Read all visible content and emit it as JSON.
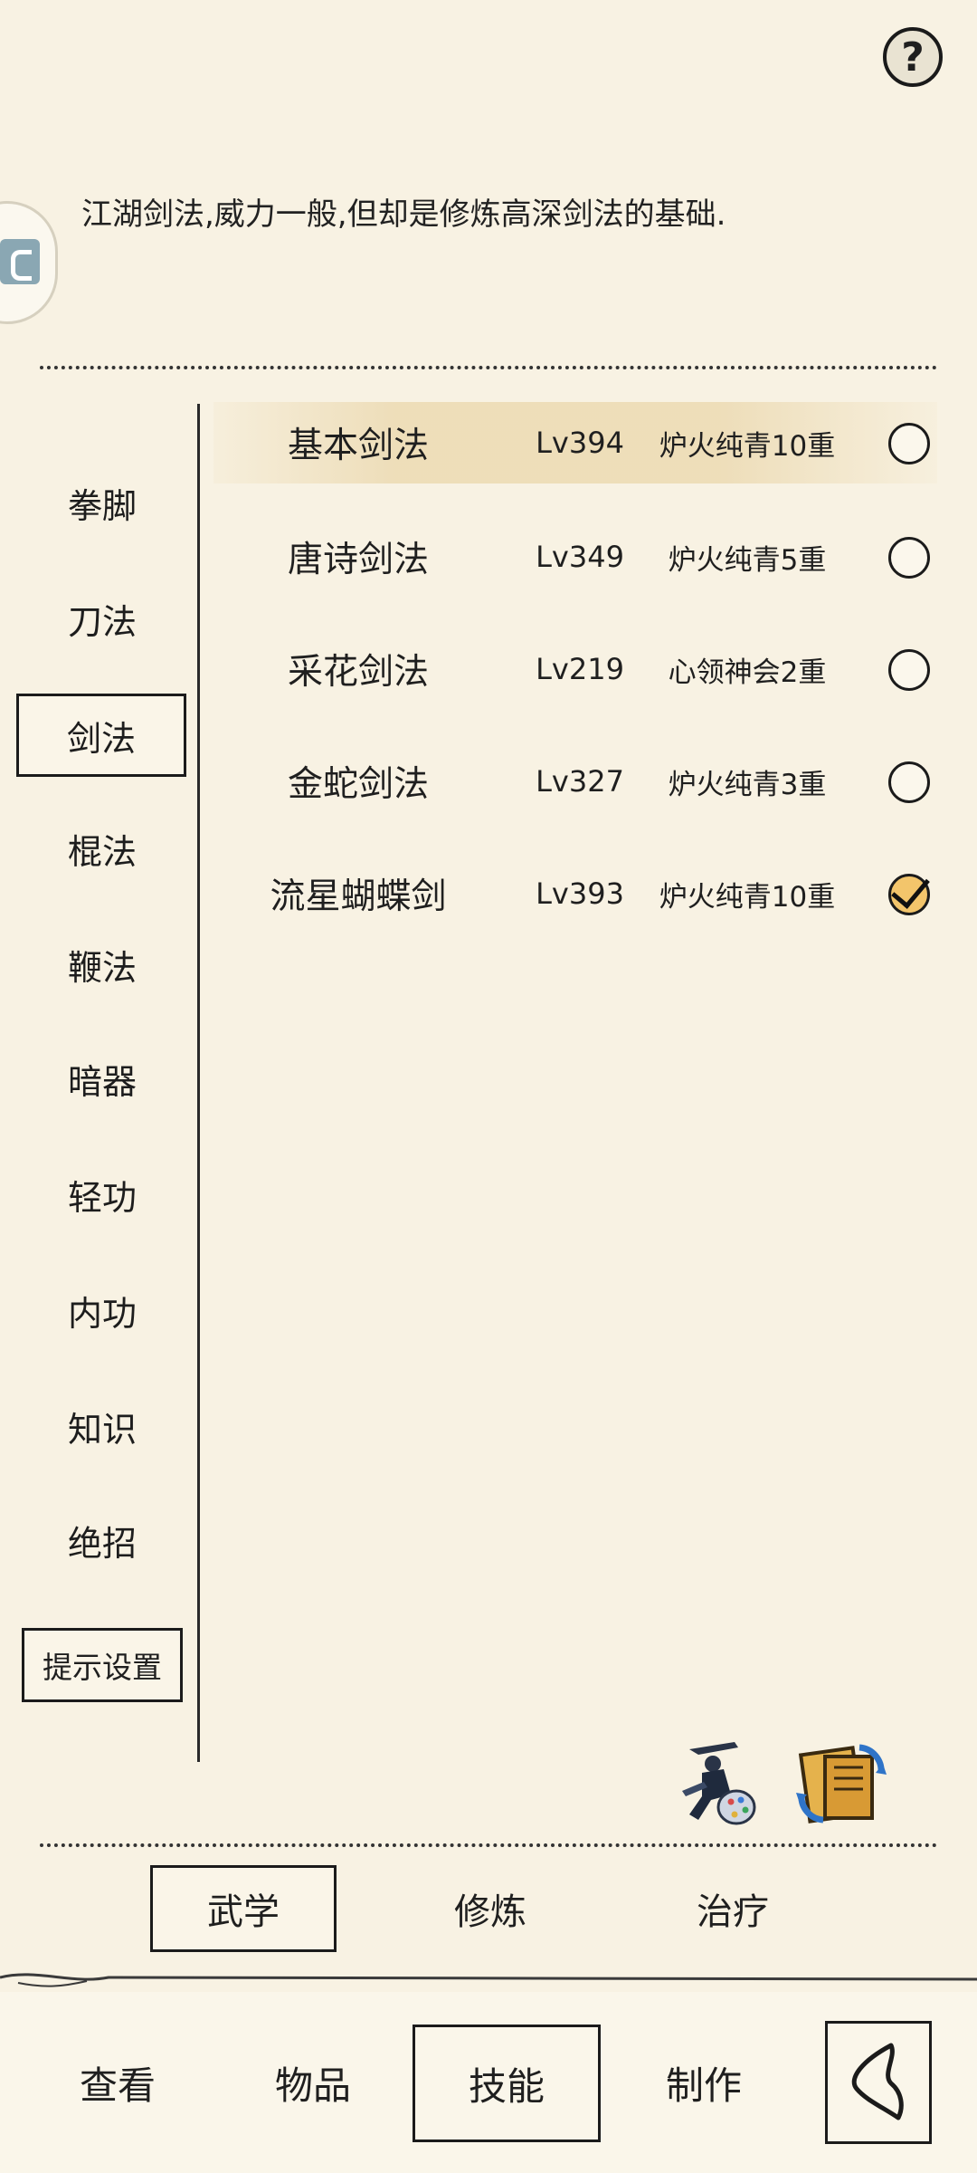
{
  "description": "江湖剑法,威力一般,但却是修炼高深剑法的基础.",
  "help_icon": "question-mark-icon",
  "categories": [
    {
      "label": "拳脚"
    },
    {
      "label": "刀法"
    },
    {
      "label": "剑法",
      "active": true
    },
    {
      "label": "棍法"
    },
    {
      "label": "鞭法"
    },
    {
      "label": "暗器"
    },
    {
      "label": "轻功"
    },
    {
      "label": "内功"
    },
    {
      "label": "知识"
    },
    {
      "label": "绝招"
    }
  ],
  "tip_settings_label": "提示设置",
  "skills": [
    {
      "name": "基本剑法",
      "level": "Lv394",
      "rank": "炉火纯青10重",
      "equipped": false,
      "highlighted": true
    },
    {
      "name": "唐诗剑法",
      "level": "Lv349",
      "rank": "炉火纯青5重",
      "equipped": false
    },
    {
      "name": "采花剑法",
      "level": "Lv219",
      "rank": "心领神会2重",
      "equipped": false
    },
    {
      "name": "金蛇剑法",
      "level": "Lv327",
      "rank": "炉火纯青3重",
      "equipped": false
    },
    {
      "name": "流星蝴蝶剑",
      "level": "Lv393",
      "rank": "炉火纯青10重",
      "equipped": true
    }
  ],
  "subtabs": [
    {
      "label": "武学",
      "active": true
    },
    {
      "label": "修炼"
    },
    {
      "label": "治疗"
    }
  ],
  "nav": [
    {
      "label": "查看"
    },
    {
      "label": "物品"
    },
    {
      "label": "技能",
      "active": true
    },
    {
      "label": "制作"
    }
  ],
  "colors": {
    "background": "#f8f2e3",
    "ink": "#1b1b1b",
    "highlight": "#ecdab2",
    "check_fill": "#f3c56b"
  }
}
